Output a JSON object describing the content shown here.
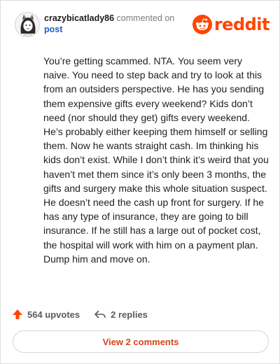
{
  "comment": {
    "username": "crazybicatlady86",
    "action_text": "commented on",
    "target_link": "post",
    "body": "You’re getting scammed. NTA. You seem very naive. You need to step back and try to look at this from an outsiders perspective. He has you sending them expensive gifts every weekend? Kids don’t need (nor should they get) gifts every weekend. He’s probably either keeping them himself or selling them. Now he wants straight cash. Im thinking his kids don’t exist. While I don’t think it’s weird that you haven’t met them since it’s only been 3 months, the gifts and surgery make this whole situation suspect. He doesn’t need the cash up front for surgery. If he has any type of insurance, they are going to bill insurance. If he still has a large out of pocket cost, the hospital will work with him on a payment plan. Dump him and move on.",
    "upvotes_label": "564 upvotes",
    "replies_label": "2 replies"
  },
  "brand": {
    "wordmark": "reddit",
    "color": "#ff4500"
  },
  "footer": {
    "view_comments_label": "View 2 comments",
    "label_color": "#d8431c"
  },
  "icons": {
    "avatar": "cat-lady-avatar",
    "logo": "reddit-snoo-icon",
    "upvote": "upvote-arrow-icon",
    "reply": "reply-arrow-icon"
  }
}
